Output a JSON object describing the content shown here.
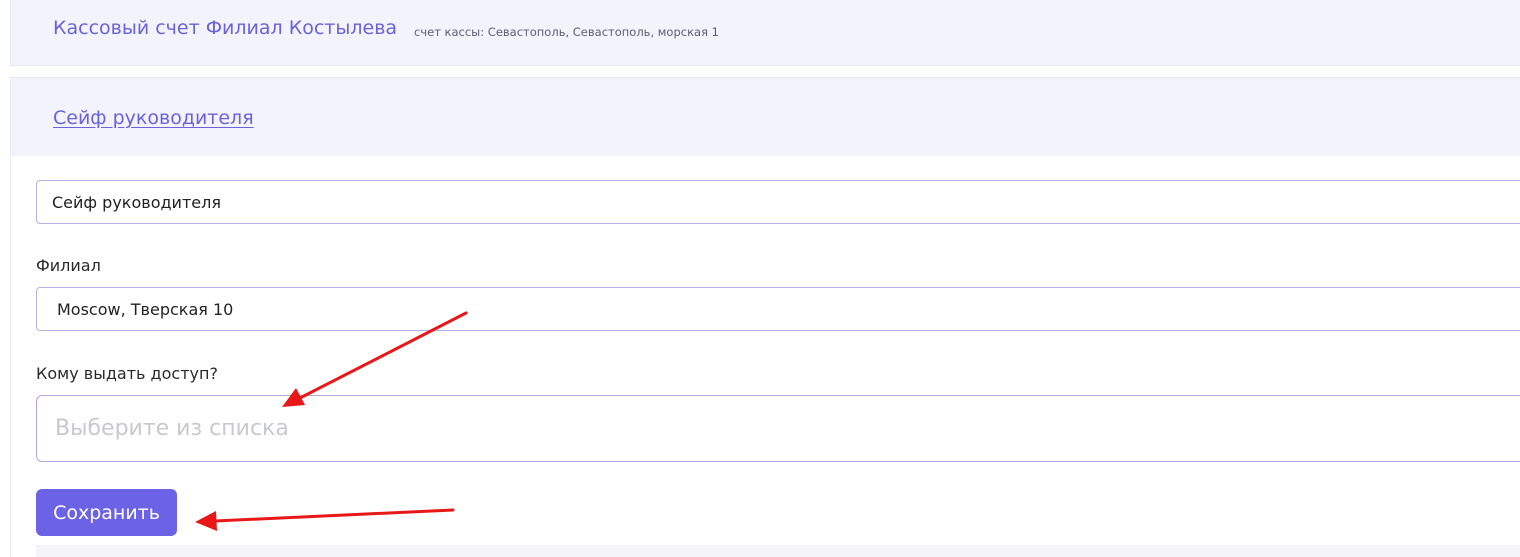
{
  "account": {
    "title": "Кассовый счет Филиал Костылева",
    "subtitle": "счет кассы: Севастополь, Севастополь, морская 1"
  },
  "safe": {
    "link_label": "Сейф руководителя"
  },
  "form": {
    "name_value": "Сейф руководителя",
    "branch_label": "Филиал",
    "branch_value": "Moscow, Тверская 10",
    "access_label": "Кому выдать доступ?",
    "access_placeholder": "Выберите из списка",
    "save_label": "Сохранить"
  },
  "colors": {
    "accent": "#6c62e6",
    "annotation": "#e81818",
    "header_bg": "#f3f3fc"
  }
}
